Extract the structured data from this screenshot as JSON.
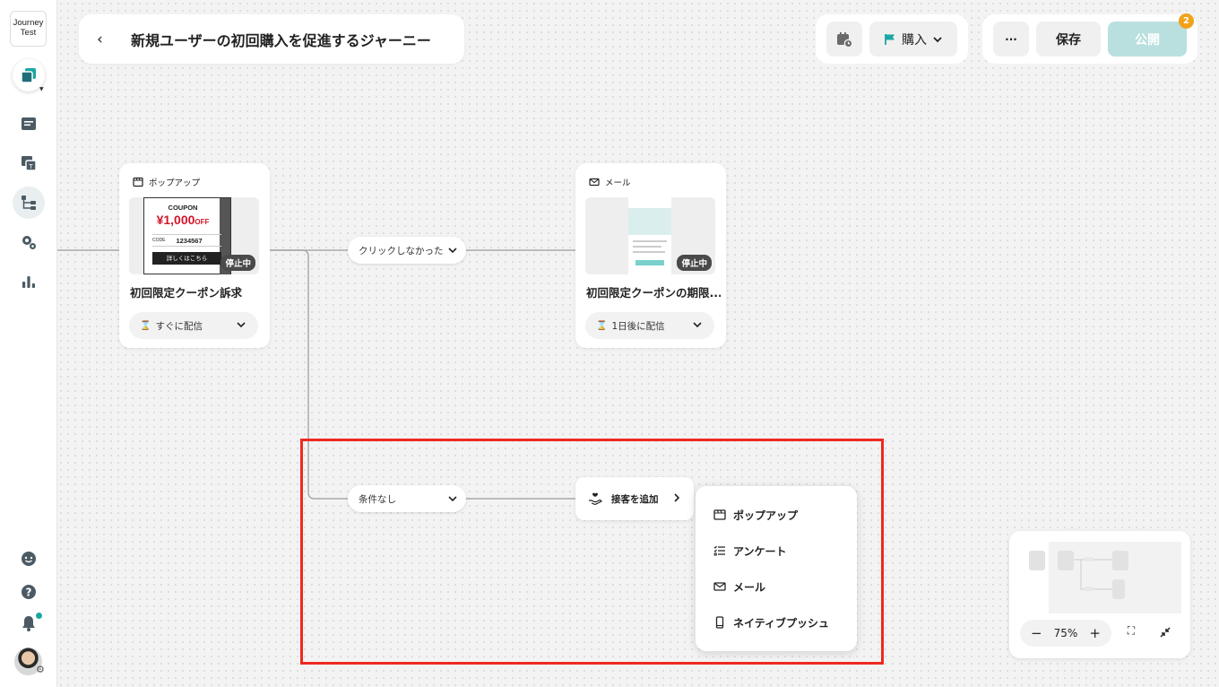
{
  "app": {
    "logo_text": "Journey\nTest"
  },
  "header": {
    "back_icon": "chevron-left-icon",
    "title": "新規ユーザーの初回購入を促進するジャーニー",
    "goal_label": "購入",
    "more_label": "···",
    "save_label": "保存",
    "publish_label": "公開",
    "publish_badge": "2"
  },
  "sidebar": {
    "items": [
      {
        "icon": "journey-switcher-icon"
      },
      {
        "icon": "campaign-list-icon"
      },
      {
        "icon": "template-icon"
      },
      {
        "icon": "journey-flow-icon",
        "active": true
      },
      {
        "icon": "settings-icon"
      },
      {
        "icon": "analytics-icon"
      },
      {
        "icon": "support-chat-icon"
      },
      {
        "icon": "help-icon"
      },
      {
        "icon": "notification-icon"
      },
      {
        "icon": "avatar"
      }
    ]
  },
  "nodes": [
    {
      "type_label": "ポップアップ",
      "name": "初回限定クーポン訴求",
      "status": "停止中",
      "delay": "すぐに配信",
      "coupon": {
        "heading": "COUPON",
        "amount": "¥1,000",
        "off": "OFF",
        "code_label": "CODE",
        "code": "1234567",
        "cta": "詳しくはこちら"
      }
    },
    {
      "type_label": "メール",
      "name": "初回限定クーポンの期限...",
      "status": "停止中",
      "delay": "1日後に配信"
    }
  ],
  "conditions": [
    "クリックしなかった",
    "条件なし"
  ],
  "add_action": {
    "label": "接客を追加"
  },
  "add_menu": {
    "items": [
      {
        "label": "ポップアップ",
        "icon": "popup-icon"
      },
      {
        "label": "アンケート",
        "icon": "survey-icon"
      },
      {
        "label": "メール",
        "icon": "mail-icon"
      },
      {
        "label": "ネイティブプッシュ",
        "icon": "mobile-push-icon"
      }
    ]
  },
  "minimap": {
    "zoom_label": "75%"
  },
  "colors": {
    "accent": "#1aa7a3",
    "publish_disabled": "#b9e0de",
    "badge": "#f2a21b",
    "highlight": "#ee2a1e"
  }
}
